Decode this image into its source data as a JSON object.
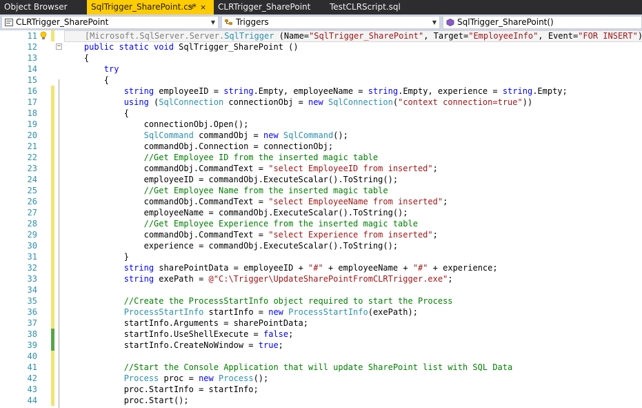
{
  "tabs": [
    {
      "label": "Object Browser"
    },
    {
      "label": "SqlTrigger_SharePoint.cs*",
      "pin": "⊣",
      "close": "×"
    },
    {
      "label": "CLRTrigger_SharePoint"
    },
    {
      "label": "TestCLRScript.sql"
    }
  ],
  "navbar": {
    "project": "CLRTrigger_SharePoint",
    "type": "Triggers",
    "member": "SqlTrigger_SharePoint()"
  },
  "colors": {
    "active_tab": "#ffcc00",
    "line_number": "#2b91af",
    "keyword": "#0000ff",
    "type": "#2b91af",
    "string": "#a31515",
    "comment": "#008000",
    "changed_unsaved": "#efe573",
    "changed_saved": "#57a64a"
  },
  "editor": {
    "lines": [
      {
        "num": "11",
        "change": "yellow",
        "icon": "lightbulb-icon",
        "tokens": [
          {
            "t": "    ",
            "c": ""
          },
          {
            "t": "[Microsoft.SqlServer.Server.",
            "c": "at"
          },
          {
            "t": "SqlTrigger",
            "c": "ty"
          },
          {
            "t": " (Name=",
            "c": ""
          },
          {
            "t": "\"SqlTrigger_SharePoint\"",
            "c": "st"
          },
          {
            "t": ", Target=",
            "c": ""
          },
          {
            "t": "\"EmployeeInfo\"",
            "c": "st"
          },
          {
            "t": ", Event=",
            "c": ""
          },
          {
            "t": "\"FOR INSERT\"",
            "c": "st"
          },
          {
            "t": ")]",
            "c": ""
          }
        ]
      },
      {
        "num": "12",
        "change": "",
        "icon": "collapse-icon",
        "tokens": [
          {
            "t": "    ",
            "c": ""
          },
          {
            "t": "public static void",
            "c": "kw"
          },
          {
            "t": " SqlTrigger_SharePoint ()",
            "c": ""
          }
        ]
      },
      {
        "num": "13",
        "change": "",
        "tokens": [
          {
            "t": "    {",
            "c": ""
          }
        ]
      },
      {
        "num": "14",
        "change": "",
        "tokens": [
          {
            "t": "        ",
            "c": ""
          },
          {
            "t": "try",
            "c": "kw"
          }
        ]
      },
      {
        "num": "15",
        "change": "",
        "tokens": [
          {
            "t": "        {",
            "c": ""
          }
        ]
      },
      {
        "num": "16",
        "change": "yellow",
        "tokens": [
          {
            "t": "            ",
            "c": ""
          },
          {
            "t": "string",
            "c": "kw"
          },
          {
            "t": " employeeID = ",
            "c": ""
          },
          {
            "t": "string",
            "c": "kw"
          },
          {
            "t": ".Empty, employeeName = ",
            "c": ""
          },
          {
            "t": "string",
            "c": "kw"
          },
          {
            "t": ".Empty, experience = ",
            "c": ""
          },
          {
            "t": "string",
            "c": "kw"
          },
          {
            "t": ".Empty;",
            "c": ""
          }
        ]
      },
      {
        "num": "17",
        "change": "yellow",
        "tokens": [
          {
            "t": "            ",
            "c": ""
          },
          {
            "t": "using",
            "c": "kw"
          },
          {
            "t": " (",
            "c": ""
          },
          {
            "t": "SqlConnection",
            "c": "ty"
          },
          {
            "t": " connectionObj = ",
            "c": ""
          },
          {
            "t": "new",
            "c": "kw"
          },
          {
            "t": " ",
            "c": ""
          },
          {
            "t": "SqlConnection",
            "c": "ty"
          },
          {
            "t": "(",
            "c": ""
          },
          {
            "t": "\"context connection=true\"",
            "c": "st"
          },
          {
            "t": "))",
            "c": ""
          }
        ]
      },
      {
        "num": "18",
        "change": "yellow",
        "tokens": [
          {
            "t": "            {",
            "c": ""
          }
        ]
      },
      {
        "num": "19",
        "change": "yellow",
        "tokens": [
          {
            "t": "                connectionObj.Open();",
            "c": ""
          }
        ]
      },
      {
        "num": "20",
        "change": "yellow",
        "tokens": [
          {
            "t": "                ",
            "c": ""
          },
          {
            "t": "SqlCommand",
            "c": "ty"
          },
          {
            "t": " commandObj = ",
            "c": ""
          },
          {
            "t": "new",
            "c": "kw"
          },
          {
            "t": " ",
            "c": ""
          },
          {
            "t": "SqlCommand",
            "c": "ty"
          },
          {
            "t": "();",
            "c": ""
          }
        ]
      },
      {
        "num": "21",
        "change": "yellow",
        "tokens": [
          {
            "t": "                commandObj.Connection = connectionObj;",
            "c": ""
          }
        ]
      },
      {
        "num": "22",
        "change": "yellow",
        "tokens": [
          {
            "t": "                ",
            "c": ""
          },
          {
            "t": "//Get Employee ID from the inserted magic table",
            "c": "cm"
          }
        ]
      },
      {
        "num": "23",
        "change": "yellow",
        "tokens": [
          {
            "t": "                commandObj.CommandText = ",
            "c": ""
          },
          {
            "t": "\"select EmployeeID from inserted\"",
            "c": "st"
          },
          {
            "t": ";",
            "c": ""
          }
        ]
      },
      {
        "num": "24",
        "change": "yellow",
        "tokens": [
          {
            "t": "                employeeID = commandObj.ExecuteScalar().ToString();",
            "c": ""
          }
        ]
      },
      {
        "num": "25",
        "change": "yellow",
        "tokens": [
          {
            "t": "                ",
            "c": ""
          },
          {
            "t": "//Get Employee Name from the inserted magic table",
            "c": "cm"
          }
        ]
      },
      {
        "num": "26",
        "change": "yellow",
        "tokens": [
          {
            "t": "                commandObj.CommandText = ",
            "c": ""
          },
          {
            "t": "\"select EmployeeName from inserted\"",
            "c": "st"
          },
          {
            "t": ";",
            "c": ""
          }
        ]
      },
      {
        "num": "27",
        "change": "yellow",
        "tokens": [
          {
            "t": "                employeeName = commandObj.ExecuteScalar().ToString();",
            "c": ""
          }
        ]
      },
      {
        "num": "28",
        "change": "yellow",
        "tokens": [
          {
            "t": "                ",
            "c": ""
          },
          {
            "t": "//Get Employee Experience from the inserted magic table",
            "c": "cm"
          }
        ]
      },
      {
        "num": "29",
        "change": "yellow",
        "tokens": [
          {
            "t": "                commandObj.CommandText = ",
            "c": ""
          },
          {
            "t": "\"select Experience from inserted\"",
            "c": "st"
          },
          {
            "t": ";",
            "c": ""
          }
        ]
      },
      {
        "num": "30",
        "change": "yellow",
        "tokens": [
          {
            "t": "                experience = commandObj.ExecuteScalar().ToString();",
            "c": ""
          }
        ]
      },
      {
        "num": "31",
        "change": "yellow",
        "tokens": [
          {
            "t": "            }",
            "c": ""
          }
        ]
      },
      {
        "num": "32",
        "change": "yellow",
        "tokens": [
          {
            "t": "            ",
            "c": ""
          },
          {
            "t": "string",
            "c": "kw"
          },
          {
            "t": " sharePointData = employeeID + ",
            "c": ""
          },
          {
            "t": "\"#\"",
            "c": "st"
          },
          {
            "t": " + employeeName + ",
            "c": ""
          },
          {
            "t": "\"#\"",
            "c": "st"
          },
          {
            "t": " + experience;",
            "c": ""
          }
        ]
      },
      {
        "num": "33",
        "change": "yellow",
        "tokens": [
          {
            "t": "            ",
            "c": ""
          },
          {
            "t": "string",
            "c": "kw"
          },
          {
            "t": " exePath = ",
            "c": ""
          },
          {
            "t": "@\"C:\\Trigger\\UpdateSharePointFromCLRTrigger.exe\"",
            "c": "st"
          },
          {
            "t": ";",
            "c": ""
          }
        ]
      },
      {
        "num": "34",
        "change": "yellow",
        "tokens": [
          {
            "t": "",
            "c": ""
          }
        ]
      },
      {
        "num": "35",
        "change": "yellow",
        "tokens": [
          {
            "t": "            ",
            "c": ""
          },
          {
            "t": "//Create the ProcessStartInfo object required to start the Process",
            "c": "cm"
          }
        ]
      },
      {
        "num": "36",
        "change": "yellow",
        "tokens": [
          {
            "t": "            ",
            "c": ""
          },
          {
            "t": "ProcessStartInfo",
            "c": "ty"
          },
          {
            "t": " startInfo = ",
            "c": ""
          },
          {
            "t": "new",
            "c": "kw"
          },
          {
            "t": " ",
            "c": ""
          },
          {
            "t": "ProcessStartInfo",
            "c": "ty"
          },
          {
            "t": "(exePath);",
            "c": ""
          }
        ]
      },
      {
        "num": "37",
        "change": "yellow",
        "tokens": [
          {
            "t": "            startInfo.Arguments = sharePointData;",
            "c": ""
          }
        ]
      },
      {
        "num": "38",
        "change": "green",
        "tokens": [
          {
            "t": "            startInfo.UseShellExecute = ",
            "c": ""
          },
          {
            "t": "false",
            "c": "kw"
          },
          {
            "t": ";",
            "c": ""
          }
        ]
      },
      {
        "num": "39",
        "change": "green",
        "tokens": [
          {
            "t": "            startInfo.CreateNoWindow = ",
            "c": ""
          },
          {
            "t": "true",
            "c": "kw"
          },
          {
            "t": ";",
            "c": ""
          }
        ]
      },
      {
        "num": "40",
        "change": "yellow",
        "tokens": [
          {
            "t": "",
            "c": ""
          }
        ]
      },
      {
        "num": "41",
        "change": "yellow",
        "tokens": [
          {
            "t": "            ",
            "c": ""
          },
          {
            "t": "//Start the Console Application that will update SharePoint list with SQL Data",
            "c": "cm"
          }
        ]
      },
      {
        "num": "42",
        "change": "yellow",
        "tokens": [
          {
            "t": "            ",
            "c": ""
          },
          {
            "t": "Process",
            "c": "ty"
          },
          {
            "t": " proc = ",
            "c": ""
          },
          {
            "t": "new",
            "c": "kw"
          },
          {
            "t": " ",
            "c": ""
          },
          {
            "t": "Process",
            "c": "ty"
          },
          {
            "t": "();",
            "c": ""
          }
        ]
      },
      {
        "num": "43",
        "change": "yellow",
        "tokens": [
          {
            "t": "            proc.StartInfo = startInfo;",
            "c": ""
          }
        ]
      },
      {
        "num": "44",
        "change": "yellow",
        "tokens": [
          {
            "t": "            proc.Start();",
            "c": ""
          }
        ]
      }
    ]
  }
}
